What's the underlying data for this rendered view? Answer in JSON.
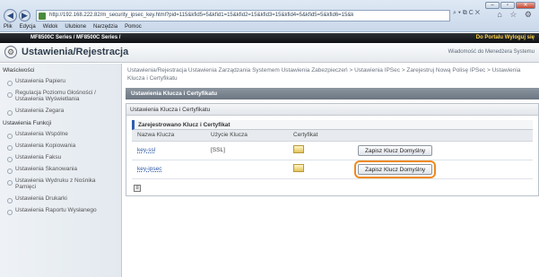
{
  "browser": {
    "address": "http://192.168.222.82/m_security_ipsec_key.html?pid=115&kfid5=5&kfid1=15&kfid2=15&kfid3=15&kfid4=5&kfid5=5&kfid6=15&k",
    "address_tools": "⌕ ▾ ⧉ C ✕",
    "right_icons": "⌂ ☆ ⚙",
    "window_buttons": [
      "–",
      "▫",
      "✕"
    ],
    "menu": [
      "Plik",
      "Edycja",
      "Widok",
      "Ulubione",
      "Narzędzia",
      "Pomoc"
    ]
  },
  "app": {
    "model": "MF8500C Series / MF8500C Series /",
    "portal_link": "Do Portalu  Wyloguj się",
    "page_title": "Ustawienia/Rejestracja",
    "manager_link": "Wiadomość do Menedżera Systemu"
  },
  "sidebar": {
    "sections": [
      {
        "heading": "Właściwości",
        "items": [
          "Ustawienia Papieru",
          "Regulacja Poziomu Głośności / Ustawienia Wyświetlania",
          "Ustawienia Zegara"
        ]
      },
      {
        "heading": "Ustawienia Funkcji",
        "items": [
          "Ustawienia Wspólne",
          "Ustawienia Kopiowania",
          "Ustawienia Faksu",
          "Ustawienia Skanowania",
          "Ustawienia Wydruku z Nośnika Pamięci",
          "Ustawienia Drukarki",
          "Ustawienia Raportu Wysłanego"
        ]
      }
    ]
  },
  "main": {
    "breadcrumb": "Ustawienia/Rejestracja Ustawienia Zarządzania Systemem Ustawienia Zabezpieczeń > Ustawienia IPSec > Zarejestruj Nową Polisę IPSec > Ustawienia Klucza i Certyfikatu",
    "section_header": "Ustawienia Klucza i Certyfikatu",
    "panel_header": "Ustawienia Klucza i Certyfikatu",
    "subheader": "Zarejestrowano Klucz i Certyfikat",
    "table": {
      "columns": [
        "Nazwa Klucza",
        "Użycie Klucza",
        "Certyfikat",
        ""
      ],
      "rows": [
        {
          "key_name": "key-ssl",
          "usage": "[SSL]",
          "button": "Zapisz Klucz Domyślny"
        },
        {
          "key_name": "key-ipsec",
          "usage": "",
          "button": "Zapisz Klucz Domyślny"
        }
      ]
    }
  }
}
